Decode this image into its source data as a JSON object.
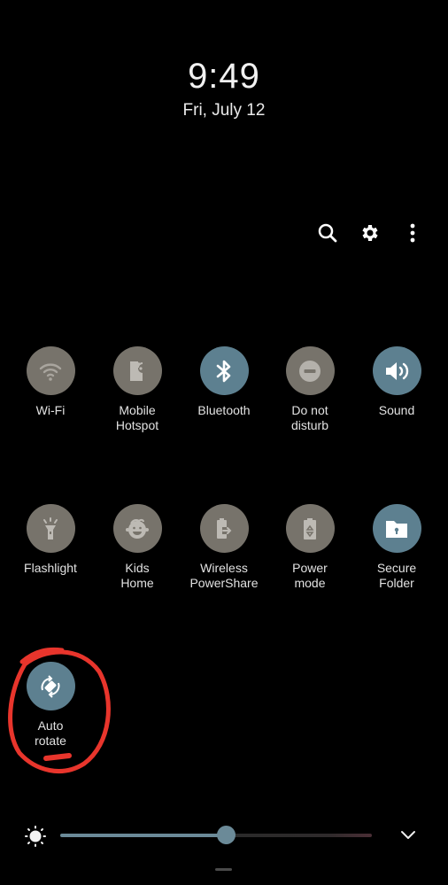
{
  "lockscreen": {
    "time": "9:49",
    "date": "Fri, July 12"
  },
  "header_actions": [
    {
      "name": "search",
      "icon": "search-icon"
    },
    {
      "name": "settings",
      "icon": "gear-icon"
    },
    {
      "name": "more-options",
      "icon": "more-vertical-icon"
    }
  ],
  "colors": {
    "tile_off": "#77736b",
    "tile_on": "#5d8090",
    "annotation": "#e8352c",
    "slider": "#6b8a98"
  },
  "tiles": [
    {
      "label": "Wi-Fi",
      "icon": "wifi-icon",
      "state": "off"
    },
    {
      "label": "Mobile Hotspot",
      "icon": "hotspot-icon",
      "state": "off"
    },
    {
      "label": "Bluetooth",
      "icon": "bluetooth-icon",
      "state": "on"
    },
    {
      "label": "Do not disturb",
      "icon": "do-not-disturb-icon",
      "state": "off"
    },
    {
      "label": "Sound",
      "icon": "sound-icon",
      "state": "on"
    },
    {
      "label": "Flashlight",
      "icon": "flashlight-icon",
      "state": "off"
    },
    {
      "label": "Kids Home",
      "icon": "kids-home-icon",
      "state": "off"
    },
    {
      "label": "Wireless PowerShare",
      "icon": "wireless-powershare-icon",
      "state": "off"
    },
    {
      "label": "Power mode",
      "icon": "power-mode-icon",
      "state": "off"
    },
    {
      "label": "Secure Folder",
      "icon": "secure-folder-icon",
      "state": "on"
    },
    {
      "label": "Auto rotate",
      "icon": "auto-rotate-icon",
      "state": "on"
    }
  ],
  "tile_labels": {
    "wifi": "Wi-Fi",
    "hotspot_1": "Mobile",
    "hotspot_2": "Hotspot",
    "bluetooth": "Bluetooth",
    "dnd_1": "Do not",
    "dnd_2": "disturb",
    "sound": "Sound",
    "flashlight": "Flashlight",
    "kids_1": "Kids",
    "kids_2": "Home",
    "wps_1": "Wireless",
    "wps_2": "PowerShare",
    "power_1": "Power",
    "power_2": "mode",
    "secure_1": "Secure",
    "secure_2": "Folder",
    "rotate_1": "Auto",
    "rotate_2": "rotate"
  },
  "brightness": {
    "level_percent": 53
  }
}
